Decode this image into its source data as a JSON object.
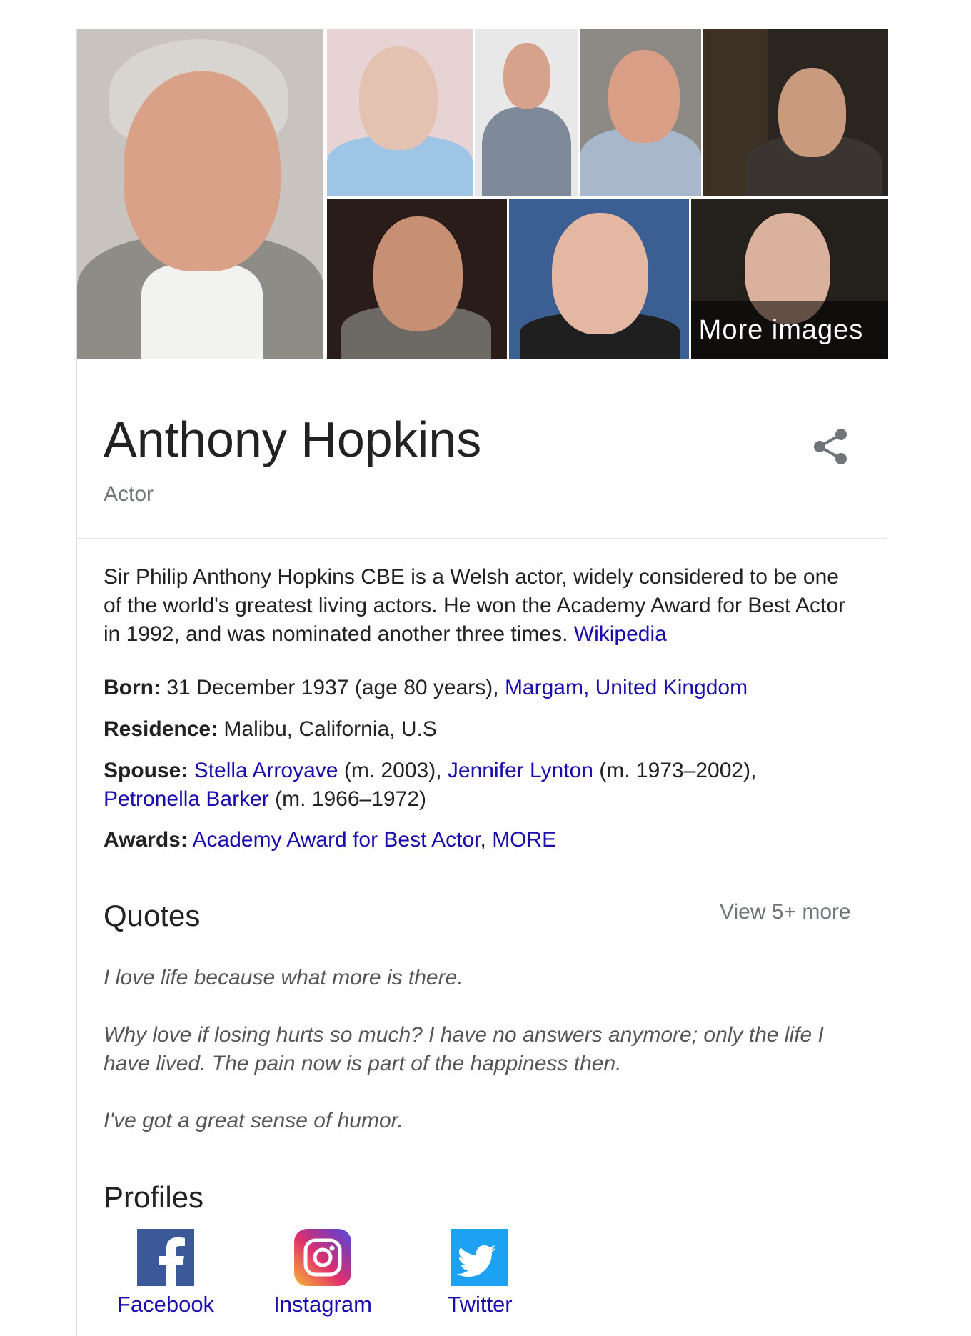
{
  "images": {
    "more_label": "More images"
  },
  "entity": {
    "name": "Anthony Hopkins",
    "type": "Actor"
  },
  "description": {
    "text": "Sir Philip Anthony Hopkins CBE is a Welsh actor, widely considered to be one of the world's greatest living actors. He won the Academy Award for Best Actor in 1992, and was nominated another three times.",
    "source_link": "Wikipedia"
  },
  "facts": {
    "born": {
      "label": "Born:",
      "value": "31 December 1937 (age 80 years),",
      "link": "Margam, United Kingdom"
    },
    "residence": {
      "label": "Residence:",
      "value": "Malibu, California, U.S"
    },
    "spouse": {
      "label": "Spouse:",
      "s1_link": "Stella Arroyave",
      "s1_note": "(m. 2003),",
      "s2_link": "Jennifer Lynton",
      "s2_note": "(m. 1973–2002),",
      "s3_link": "Petronella Barker",
      "s3_note": "(m. 1966–1972)"
    },
    "awards": {
      "label": "Awards:",
      "link": "Academy Award for Best Actor",
      "sep": ",",
      "more": "MORE"
    }
  },
  "quotes": {
    "title": "Quotes",
    "view_more": "View 5+ more",
    "items": [
      "I love life because what more is there.",
      "Why love if losing hurts so much? I have no answers anymore; only the life I have lived. The pain now is part of the happiness then.",
      "I've got a great sense of humor."
    ]
  },
  "profiles": {
    "title": "Profiles",
    "items": [
      {
        "label": "Facebook",
        "icon": "facebook-icon"
      },
      {
        "label": "Instagram",
        "icon": "instagram-icon"
      },
      {
        "label": "Twitter",
        "icon": "twitter-icon"
      }
    ]
  },
  "colors": {
    "link": "#1a0dab",
    "muted": "#70757a",
    "facebook": "#3b5998",
    "twitter": "#1da1f2"
  }
}
